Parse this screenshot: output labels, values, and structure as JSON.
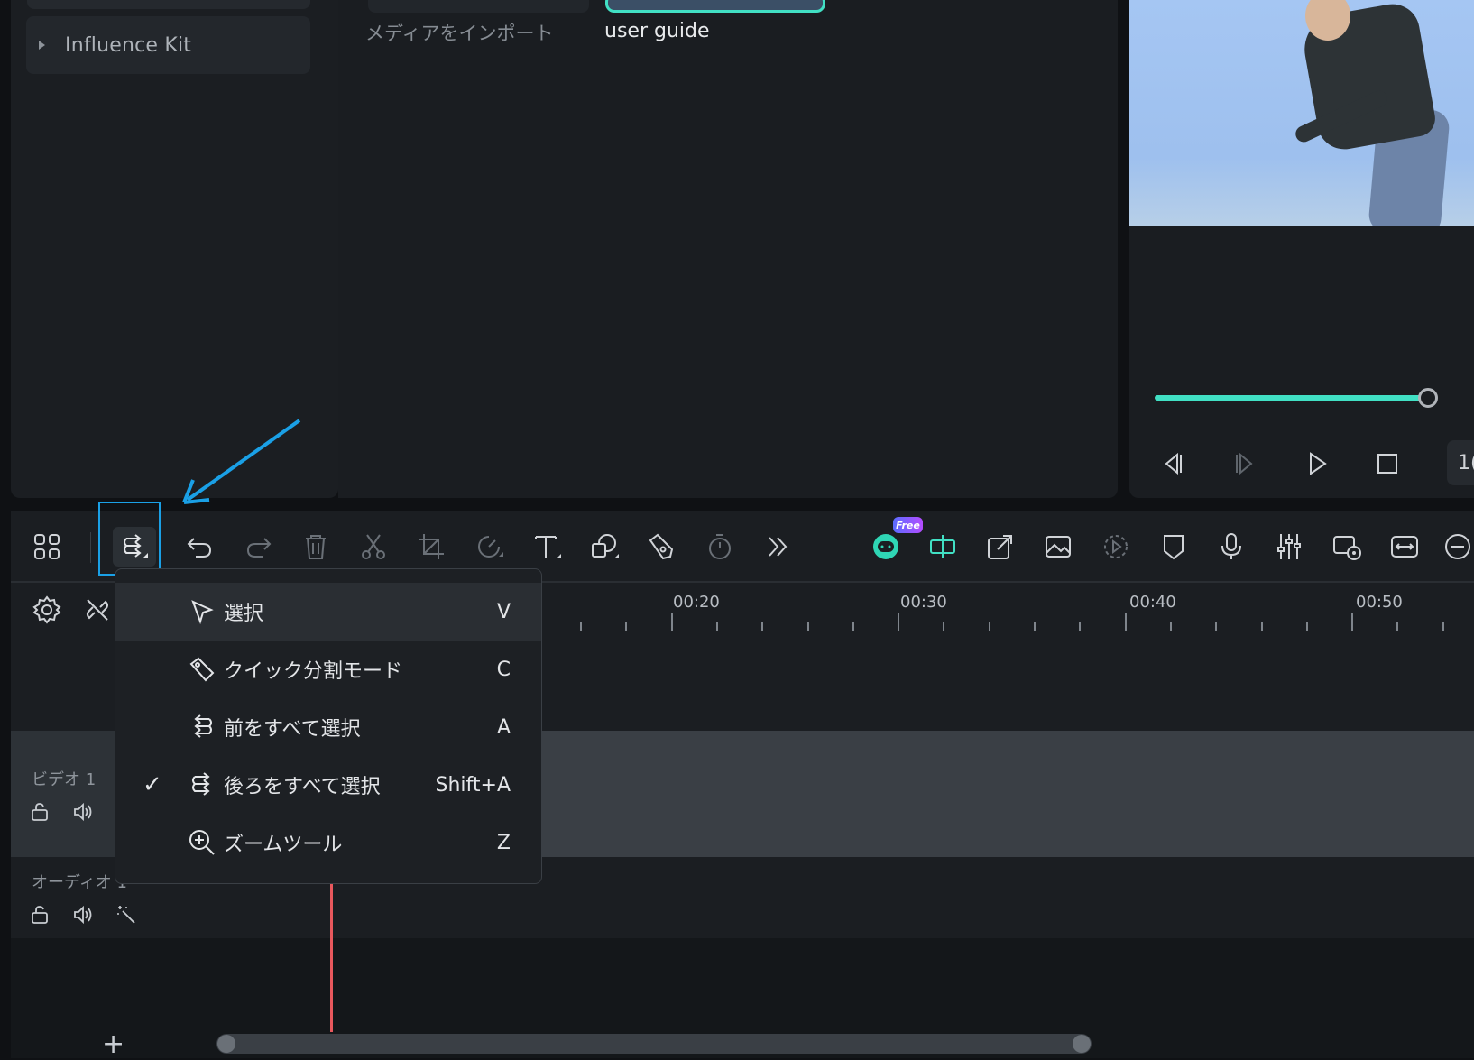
{
  "sidebar": {
    "item_label": "Influence Kit"
  },
  "media": {
    "import_label": "メディアをインポート",
    "clip_label": "user guide"
  },
  "preview": {
    "speed_label": "1(",
    "progress_fraction": 0.97
  },
  "toolbar": {
    "free_badge": "Free",
    "icons": [
      "grid-icon",
      "select-tool-icon",
      "undo-icon",
      "redo-icon",
      "delete-icon",
      "cut-icon",
      "crop-icon",
      "speed-icon",
      "text-icon",
      "shape-icon",
      "pen-icon",
      "timer-icon",
      "more-icon",
      "ai-copilot-icon",
      "split-icon",
      "export-icon",
      "image-icon",
      "replay-icon",
      "marker-icon",
      "mic-icon",
      "mixer-icon",
      "screen-record-icon",
      "fit-icon",
      "zoom-out-icon"
    ]
  },
  "timeline": {
    "ruler_labels": [
      "00:20",
      "00:30",
      "00:40",
      "00:50"
    ],
    "tracks": [
      {
        "name": "ビデオ 1"
      },
      {
        "name": "オーディオ 1"
      }
    ],
    "add_track_label": "+"
  },
  "menu": {
    "items": [
      {
        "label": "選択",
        "key": "V",
        "checked": false,
        "icon": "pointer-icon"
      },
      {
        "label": "クイック分割モード",
        "key": "C",
        "checked": false,
        "icon": "blade-icon"
      },
      {
        "label": "前をすべて選択",
        "key": "A",
        "checked": false,
        "icon": "select-backward-icon"
      },
      {
        "label": "後ろをすべて選択",
        "key": "Shift+A",
        "checked": true,
        "icon": "select-forward-icon"
      },
      {
        "label": "ズームツール",
        "key": "Z",
        "checked": false,
        "icon": "zoom-icon"
      }
    ],
    "check_mark": "✓"
  },
  "colors": {
    "accent": "#41e0c4",
    "highlight": "#1aa0e6",
    "playhead": "#e8585d"
  }
}
